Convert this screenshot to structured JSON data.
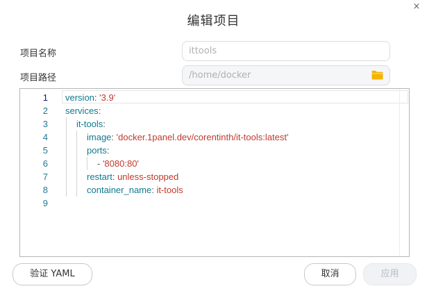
{
  "dialog": {
    "title": "编辑项目",
    "close_glyph": "×"
  },
  "form": {
    "name_label": "项目名称",
    "name_value": "ittools",
    "path_label": "项目路径",
    "path_value": "/home/docker",
    "path_icon": "folder-icon"
  },
  "editor": {
    "line_numbers": [
      "1",
      "2",
      "3",
      "4",
      "5",
      "6",
      "7",
      "8",
      "9"
    ],
    "lines": [
      {
        "key": "version",
        "sep": ": ",
        "value": "'3.9'"
      },
      {
        "key": "services",
        "sep": ":",
        "value": ""
      },
      {
        "key": "it-tools",
        "sep": ":",
        "value": ""
      },
      {
        "key": "image",
        "sep": ": ",
        "value": "'docker.1panel.dev/corentinth/it-tools:latest'"
      },
      {
        "key": "ports",
        "sep": ":",
        "value": ""
      },
      {
        "dash": "- ",
        "value": "'8080:80'"
      },
      {
        "key": "restart",
        "sep": ": ",
        "value": "unless-stopped"
      },
      {
        "key": "container_name",
        "sep": ": ",
        "value": "it-tools"
      }
    ]
  },
  "buttons": {
    "validate": "验证 YAML",
    "cancel": "取消",
    "apply": "应用"
  },
  "colors": {
    "yaml_key": "#0e7a8c",
    "yaml_string": "#c0392b",
    "line_number": "#237893",
    "folder": "#f5b400"
  }
}
